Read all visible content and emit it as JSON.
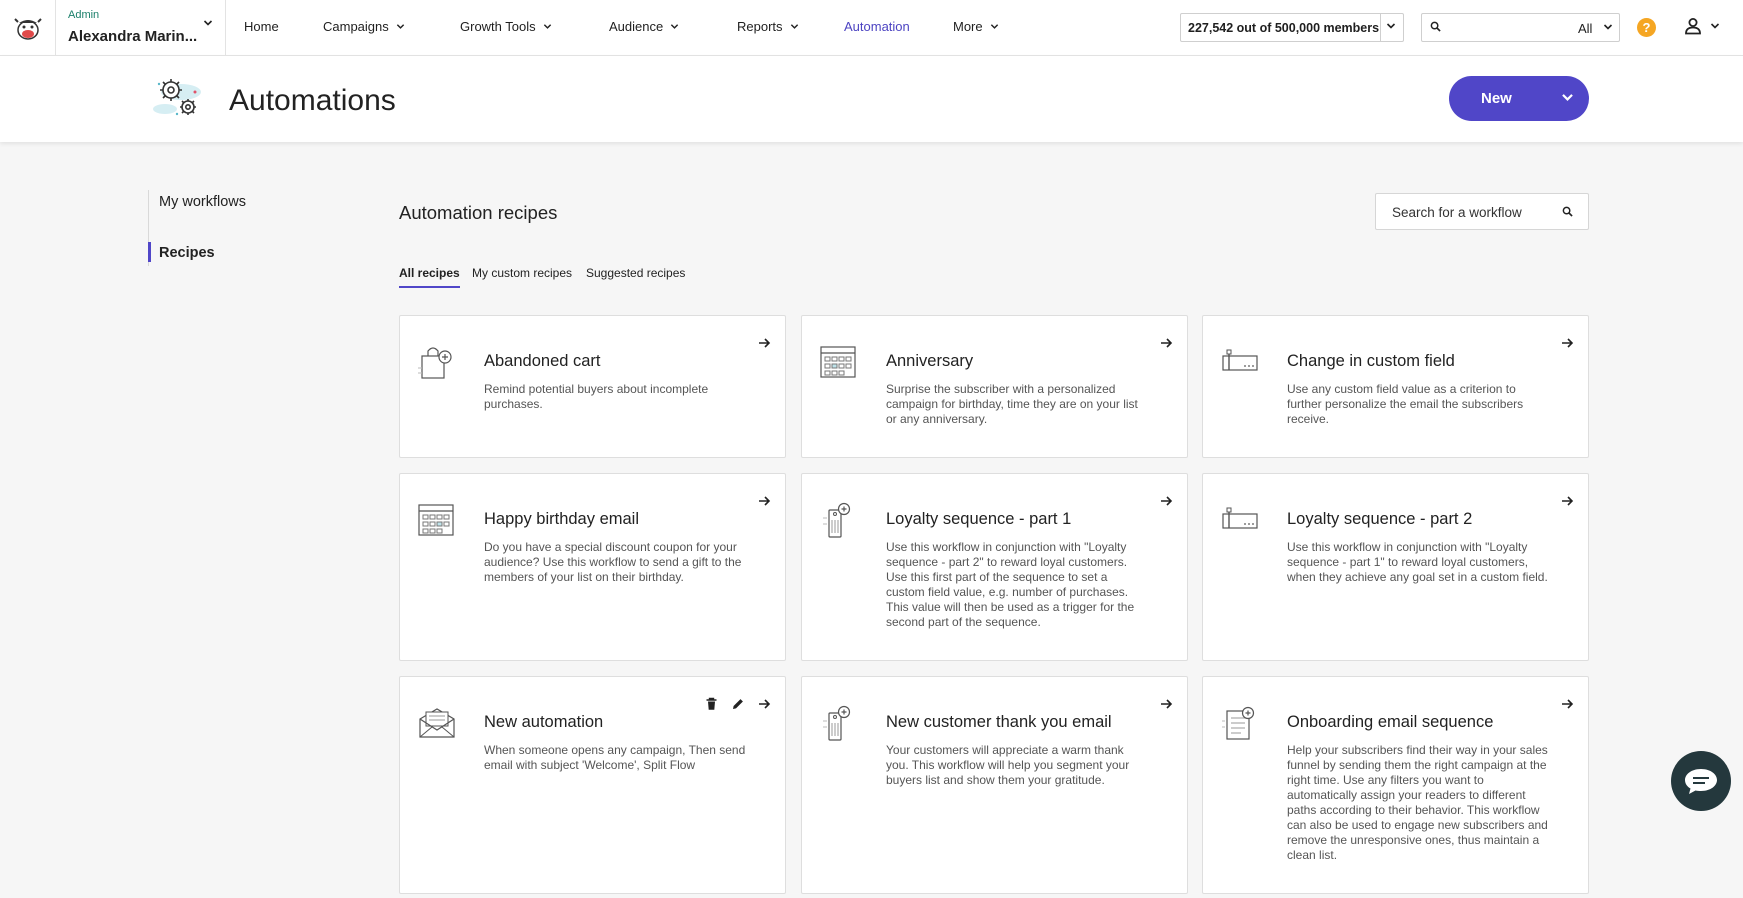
{
  "account": {
    "role": "Admin",
    "name": "Alexandra Marin..."
  },
  "nav": {
    "items": [
      {
        "label": "Home",
        "has_menu": false
      },
      {
        "label": "Campaigns",
        "has_menu": true
      },
      {
        "label": "Growth Tools",
        "has_menu": true
      },
      {
        "label": "Audience",
        "has_menu": true
      },
      {
        "label": "Reports",
        "has_menu": true
      },
      {
        "label": "Automation",
        "has_menu": false,
        "active": true
      },
      {
        "label": "More",
        "has_menu": true
      }
    ]
  },
  "members": {
    "label": "227,542 out of 500,000 members"
  },
  "top_search": {
    "placeholder": "",
    "scope": "All"
  },
  "help": {
    "label": "?"
  },
  "header": {
    "title": "Automations",
    "new_button": "New"
  },
  "sidebar": {
    "items": [
      {
        "label": "My workflows",
        "active": false
      },
      {
        "label": "Recipes",
        "active": true
      }
    ]
  },
  "main": {
    "section_title": "Automation recipes",
    "search": {
      "placeholder": "Search for a workflow"
    },
    "tabs": [
      {
        "label": "All recipes",
        "active": true
      },
      {
        "label": "My custom recipes",
        "active": false
      },
      {
        "label": "Suggested recipes",
        "active": false
      }
    ],
    "cards": [
      {
        "title": "Abandoned cart",
        "description": "Remind potential buyers about incomplete purchases.",
        "icon": "shopping-bag-icon"
      },
      {
        "title": "Anniversary",
        "description": "Surprise the subscriber with a personalized campaign for birthday, time they are on your list or any anniversary.",
        "icon": "calendar-icon"
      },
      {
        "title": "Change in custom field",
        "description": "Use any custom field value as a criterion to further personalize the email the subscribers receive.",
        "icon": "custom-field-icon"
      },
      {
        "title": "Happy birthday email",
        "description": "Do you have a special discount coupon for your audience? Use this workflow to send a gift to the members of your list on their birthday.",
        "icon": "calendar-icon"
      },
      {
        "title": "Loyalty sequence - part 1",
        "description": "Use this workflow in conjunction with \"Loyalty sequence - part 2\" to reward loyal customers. Use this first part of the sequence to set a custom field value, e.g. number of purchases. This value will then be used as a trigger for the second part of the sequence.",
        "icon": "loyalty-tag-icon"
      },
      {
        "title": "Loyalty sequence - part 2",
        "description": "Use this workflow in conjunction with \"Loyalty sequence - part 1\" to reward loyal customers, when they achieve any goal set in a custom field.",
        "icon": "custom-field-icon"
      },
      {
        "title": "New automation",
        "description": "When someone opens any campaign, Then send email with subject 'Welcome', Split Flow",
        "icon": "envelope-icon",
        "editable": true
      },
      {
        "title": "New customer thank you email",
        "description": "Your customers will appreciate a warm thank you. This workflow will help you segment your buyers list and show them your gratitude.",
        "icon": "loyalty-tag-icon"
      },
      {
        "title": "Onboarding email sequence",
        "description": "Help your subscribers find their way in your sales funnel by sending them the right campaign at the right time. Use any filters you want to automatically assign your readers to different paths according to their behavior. This workflow can also be used to engage new subscribers and remove the unresponsive ones, thus maintain a clean list.",
        "icon": "document-add-icon"
      }
    ]
  },
  "colors": {
    "accent": "#5046c8",
    "active_nav": "#4d44c2",
    "help": "#f5a623",
    "chat": "#24383d",
    "admin_label": "#1a7f6a"
  }
}
